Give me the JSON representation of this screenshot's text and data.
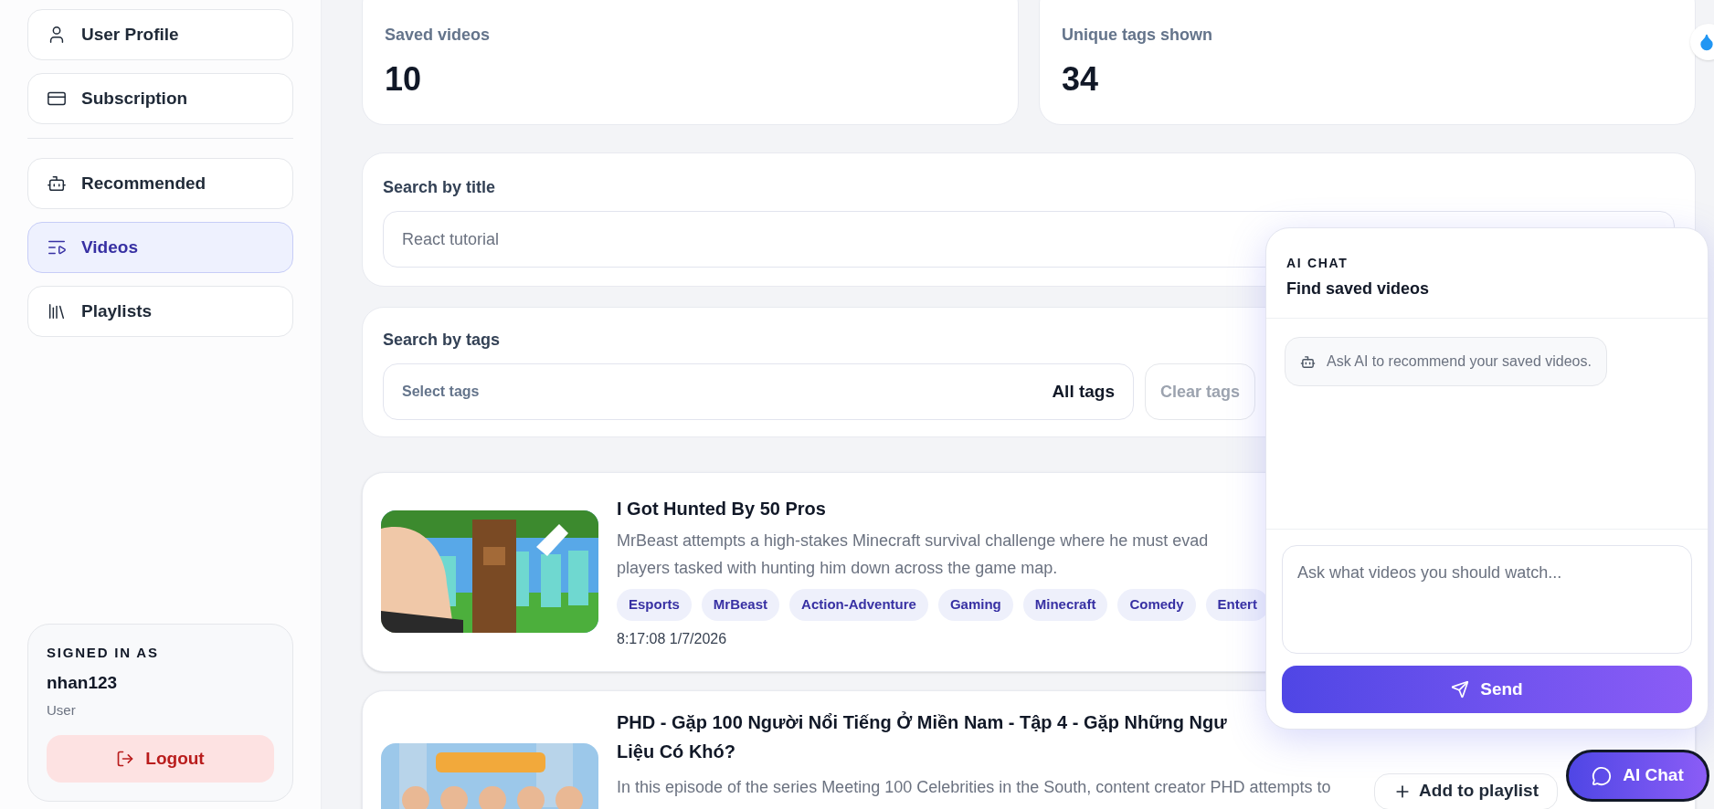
{
  "sidebar": {
    "account_items": [
      {
        "label": "User Profile",
        "selected": false
      },
      {
        "label": "Subscription",
        "selected": false
      }
    ],
    "nav_items": [
      {
        "label": "Recommended",
        "selected": false
      },
      {
        "label": "Videos",
        "selected": true
      },
      {
        "label": "Playlists",
        "selected": false
      }
    ],
    "signed_in": {
      "heading": "SIGNED IN AS",
      "username": "nhan123",
      "role": "User",
      "logout": "Logout"
    }
  },
  "stats": [
    {
      "label": "Saved videos",
      "value": "10"
    },
    {
      "label": "Unique tags shown",
      "value": "34"
    }
  ],
  "title_search": {
    "label": "Search by title",
    "placeholder": "React tutorial"
  },
  "tag_search": {
    "label": "Search by tags",
    "select_label": "Select tags",
    "select_value": "All tags",
    "clear": "Clear tags",
    "clear_disabled": true
  },
  "videos": [
    {
      "title_lines": [
        "I Got Hunted By 50 Pros"
      ],
      "description_lines": [
        "MrBeast attempts a high-stakes Minecraft survival challenge where he must evad",
        "players tasked with hunting him down across the game map."
      ],
      "tags": [
        "Esports",
        "MrBeast",
        "Action-Adventure",
        "Gaming",
        "Minecraft",
        "Comedy",
        "Entert"
      ],
      "saved_at": "8:17:08 1/7/2026"
    },
    {
      "title_lines": [
        "PHD - Gặp 100 Người Nổi Tiếng Ở Miền Nam - Tập 4 - Gặp Những Ngư",
        "Liệu Có Khó?"
      ],
      "description_lines": [
        "In this episode of the series Meeting 100 Celebrities in the South, content creator PHD attempts to"
      ],
      "add_button": "Add to playlist"
    }
  ],
  "chat": {
    "eyebrow": "AI CHAT",
    "title": "Find saved videos",
    "messages": [
      {
        "text": "Ask AI to recommend your saved videos."
      }
    ],
    "placeholder": "Ask what videos you should watch...",
    "send": "Send"
  },
  "chat_toggle": {
    "label": "AI Chat",
    "open": true
  }
}
